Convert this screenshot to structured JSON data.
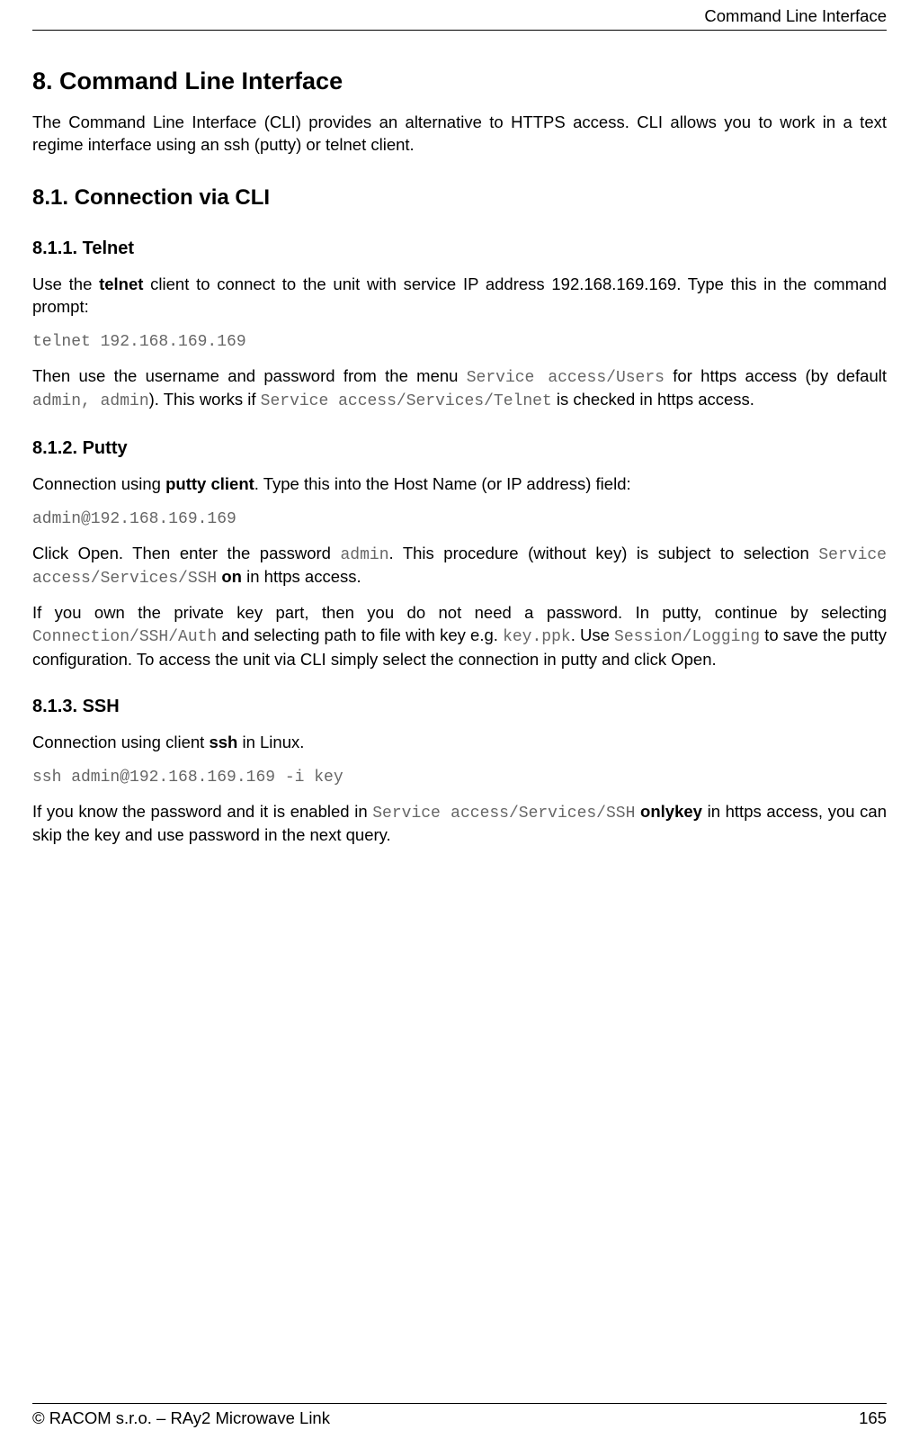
{
  "header": {
    "title": "Command Line Interface"
  },
  "h1": "8. Command Line Interface",
  "intro": "The Command Line Interface (CLI) provides an alternative to HTTPS access. CLI allows you to work in a text regime interface using an ssh (putty) or telnet client.",
  "h2": "8.1. Connection via CLI",
  "s811": {
    "h": "8.1.1. Telnet",
    "p1a": "Use the ",
    "p1b": "telnet",
    "p1c": " client to connect to the unit with service IP address 192.168.169.169. Type this in the command prompt:",
    "cmd": "telnet 192.168.169.169",
    "p2a": "Then use the username and password from the menu ",
    "p2b": "Service access/Users",
    "p2c": " for https access (by default ",
    "p2d": "admin, admin",
    "p2e": "). This works if ",
    "p2f": "Service access/Services/Telnet",
    "p2g": " is checked in https access."
  },
  "s812": {
    "h": "8.1.2. Putty",
    "p1a": "Connection using ",
    "p1b": "putty client",
    "p1c": ". Type this into the Host Name (or IP address) field:",
    "cmd": "admin@192.168.169.169",
    "p2a": "Click Open. Then enter the password ",
    "p2b": "admin",
    "p2c": ". This procedure (without key) is subject to selection ",
    "p2d": "Service access/Services/SSH",
    "p2e": " ",
    "p2f": "on",
    "p2g": " in https access.",
    "p3a": "If you own the private key part, then you do not need a password. In putty, continue by selecting ",
    "p3b": "Connection/SSH/Auth",
    "p3c": " and selecting path to file with key e.g. ",
    "p3d": "key.ppk",
    "p3e": ". Use ",
    "p3f": "Session/Logging",
    "p3g": " to save the putty configuration. To access the unit via CLI simply select the connection in putty and click Open."
  },
  "s813": {
    "h": "8.1.3. SSH",
    "p1a": "Connection using client ",
    "p1b": "ssh",
    "p1c": " in Linux.",
    "cmd": "ssh admin@192.168.169.169 -i key",
    "p2a": "If you know the password and it is enabled in ",
    "p2b": "Service access/Services/SSH",
    "p2c": " ",
    "p2d": "onlykey",
    "p2e": " in https access, you can skip the key and use password in the next query."
  },
  "footer": {
    "left": "© RACOM s.r.o. – RAy2 Microwave Link",
    "right": "165"
  }
}
